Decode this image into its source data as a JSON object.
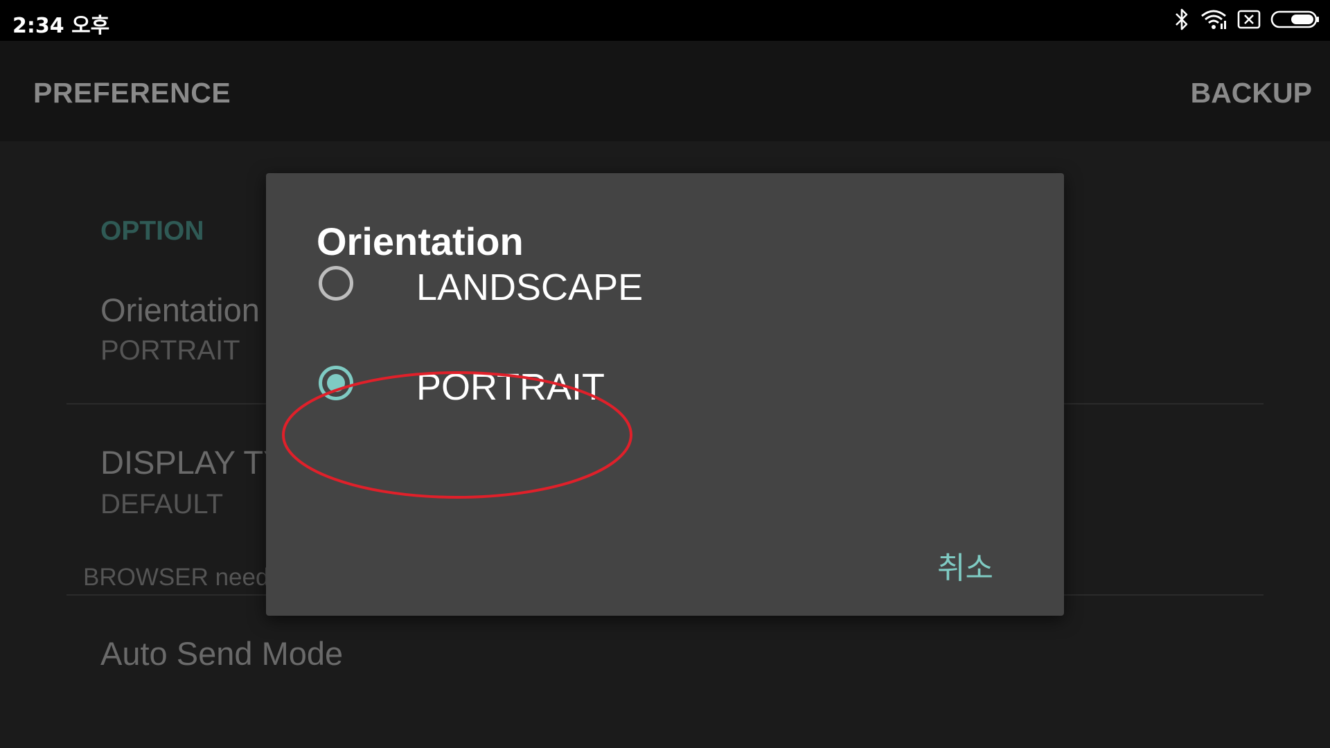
{
  "status_bar": {
    "time": "2:34 오후",
    "icons": [
      "bluetooth-icon",
      "wifi-icon",
      "sim-off-icon",
      "battery-icon"
    ]
  },
  "app_bar": {
    "title": "PREFERENCE",
    "action": "BACKUP"
  },
  "preferences": {
    "section_header": "OPTION",
    "items": [
      {
        "title": "Orientation",
        "summary": "PORTRAIT"
      },
      {
        "title": "DISPLAY TY",
        "summary": "DEFAULT",
        "note": "BROWSER needs"
      },
      {
        "title": "Auto Send Mode"
      }
    ]
  },
  "dialog": {
    "title": "Orientation",
    "options": [
      {
        "label": "LANDSCAPE",
        "selected": false
      },
      {
        "label": "PORTRAIT",
        "selected": true
      }
    ],
    "cancel_label": "취소"
  },
  "colors": {
    "accent": "#7fcbc3",
    "dialog_bg": "#444444",
    "annotation": "#e0202a"
  }
}
